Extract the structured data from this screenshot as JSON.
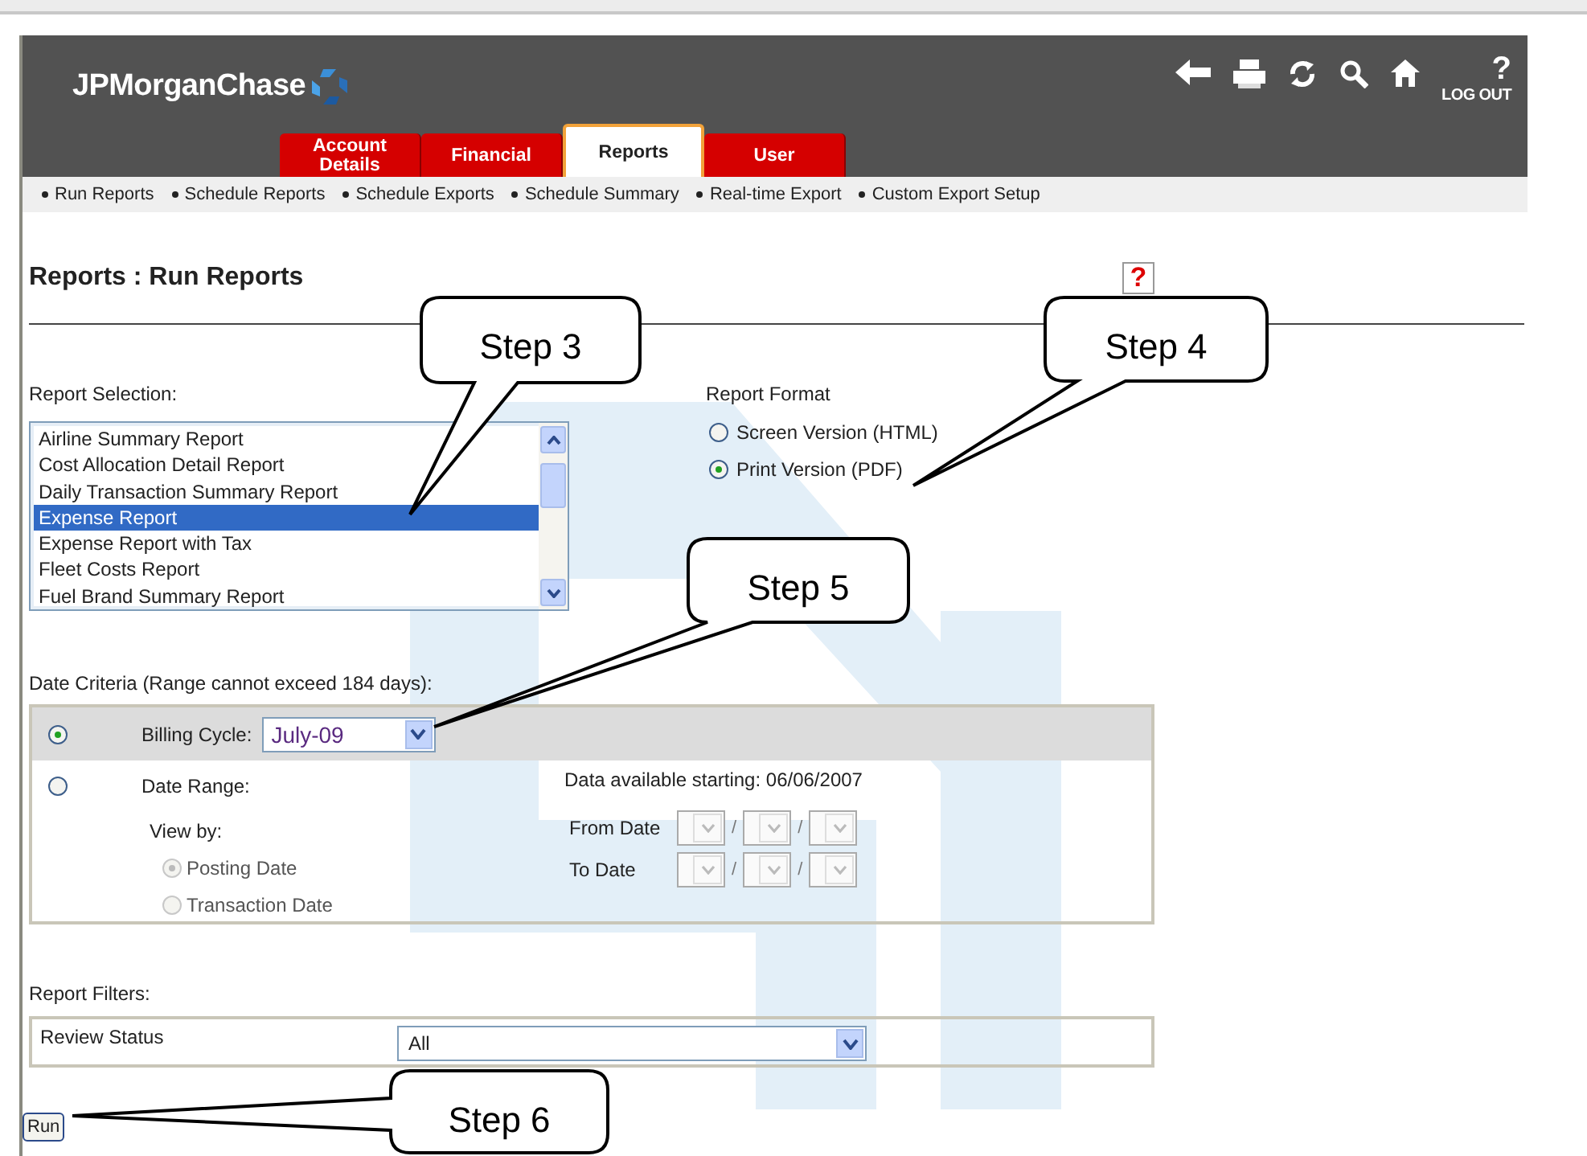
{
  "header": {
    "logo": "JPMorganChase",
    "help": "?",
    "logout": "LOG OUT"
  },
  "tabs": [
    {
      "label": "Account Details",
      "selected": false
    },
    {
      "label": "Financial",
      "selected": false
    },
    {
      "label": "Reports",
      "selected": true
    },
    {
      "label": "User",
      "selected": false
    }
  ],
  "subnav": [
    "Run Reports",
    "Schedule Reports",
    "Schedule Exports",
    "Schedule Summary",
    "Real-time Export",
    "Custom Export Setup"
  ],
  "page_title": "Reports : Run Reports",
  "help_icon": "?",
  "report_selection": {
    "label": "Report Selection:",
    "items": [
      {
        "label": "Airline Summary Report",
        "selected": false
      },
      {
        "label": "Cost Allocation Detail Report",
        "selected": false
      },
      {
        "label": "Daily Transaction Summary Report",
        "selected": false
      },
      {
        "label": "Expense Report",
        "selected": true
      },
      {
        "label": "Expense Report with Tax",
        "selected": false
      },
      {
        "label": "Fleet Costs Report",
        "selected": false
      },
      {
        "label": "Fuel Brand Summary Report",
        "selected": false
      }
    ]
  },
  "report_format": {
    "label": "Report Format",
    "options": [
      {
        "label": "Screen Version (HTML)",
        "selected": false
      },
      {
        "label": "Print Version (PDF)",
        "selected": true
      }
    ]
  },
  "date_criteria": {
    "label": "Date Criteria (Range cannot exceed 184 days):",
    "billing_cycle": {
      "label": "Billing Cycle:",
      "selected": true,
      "value": "July-09"
    },
    "date_range": {
      "label": "Date Range:",
      "selected": false,
      "disabled": true,
      "note": "Data available starting: 06/06/2007",
      "view_by_label": "View by:",
      "view_by": [
        {
          "label": "Posting Date",
          "selected": true
        },
        {
          "label": "Transaction Date",
          "selected": false
        }
      ],
      "from_label": "From Date",
      "from_separators": [
        "/",
        "/"
      ],
      "to_label": "To Date",
      "to_separators": [
        "/",
        "/"
      ]
    }
  },
  "report_filters": {
    "label": "Report Filters:",
    "review_status": {
      "label": "Review Status",
      "value": "All"
    }
  },
  "run_button": "Run",
  "callouts": [
    "Step 3",
    "Step 4",
    "Step 5",
    "Step 6"
  ]
}
